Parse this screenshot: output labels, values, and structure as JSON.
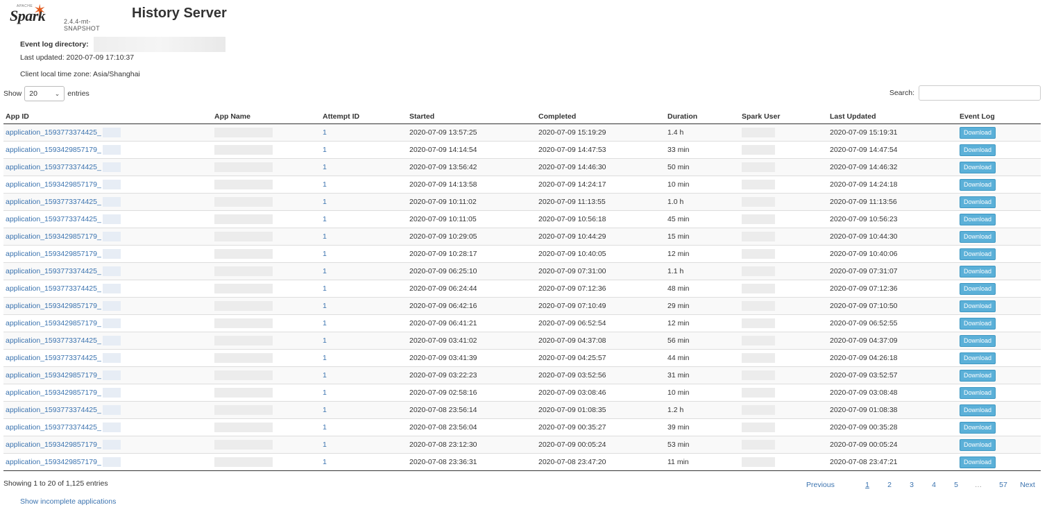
{
  "logo": {
    "wordmark": "Spark",
    "apache": "APACHE",
    "version": "2.4.4-mt-SNAPSHOT"
  },
  "page_title": "History Server",
  "info": {
    "event_log_label": "Event log directory:",
    "last_updated": "Last updated: 2020-07-09 17:10:37",
    "timezone": "Client local time zone: Asia/Shanghai"
  },
  "controls": {
    "show_label": "Show",
    "entries_label": "entries",
    "page_size": "20",
    "search_label": "Search:"
  },
  "columns": [
    "App ID",
    "App Name",
    "Attempt ID",
    "Started",
    "Completed",
    "Duration",
    "Spark User",
    "Last Updated",
    "Event Log"
  ],
  "rows": [
    {
      "app_id": "application_1593773374425_",
      "attempt": "1",
      "started": "2020-07-09 13:57:25",
      "completed": "2020-07-09 15:19:29",
      "duration": "1.4 h",
      "last_updated": "2020-07-09 15:19:31",
      "event_log": "Download"
    },
    {
      "app_id": "application_1593429857179_",
      "attempt": "1",
      "started": "2020-07-09 14:14:54",
      "completed": "2020-07-09 14:47:53",
      "duration": "33 min",
      "last_updated": "2020-07-09 14:47:54",
      "event_log": "Download"
    },
    {
      "app_id": "application_1593773374425_",
      "attempt": "1",
      "started": "2020-07-09 13:56:42",
      "completed": "2020-07-09 14:46:30",
      "duration": "50 min",
      "last_updated": "2020-07-09 14:46:32",
      "event_log": "Download"
    },
    {
      "app_id": "application_1593429857179_",
      "attempt": "1",
      "started": "2020-07-09 14:13:58",
      "completed": "2020-07-09 14:24:17",
      "duration": "10 min",
      "last_updated": "2020-07-09 14:24:18",
      "event_log": "Download"
    },
    {
      "app_id": "application_1593773374425_",
      "attempt": "1",
      "started": "2020-07-09 10:11:02",
      "completed": "2020-07-09 11:13:55",
      "duration": "1.0 h",
      "last_updated": "2020-07-09 11:13:56",
      "event_log": "Download"
    },
    {
      "app_id": "application_1593773374425_",
      "attempt": "1",
      "started": "2020-07-09 10:11:05",
      "completed": "2020-07-09 10:56:18",
      "duration": "45 min",
      "last_updated": "2020-07-09 10:56:23",
      "event_log": "Download"
    },
    {
      "app_id": "application_1593429857179_",
      "attempt": "1",
      "started": "2020-07-09 10:29:05",
      "completed": "2020-07-09 10:44:29",
      "duration": "15 min",
      "last_updated": "2020-07-09 10:44:30",
      "event_log": "Download"
    },
    {
      "app_id": "application_1593429857179_",
      "attempt": "1",
      "started": "2020-07-09 10:28:17",
      "completed": "2020-07-09 10:40:05",
      "duration": "12 min",
      "last_updated": "2020-07-09 10:40:06",
      "event_log": "Download"
    },
    {
      "app_id": "application_1593773374425_",
      "attempt": "1",
      "started": "2020-07-09 06:25:10",
      "completed": "2020-07-09 07:31:00",
      "duration": "1.1 h",
      "last_updated": "2020-07-09 07:31:07",
      "event_log": "Download"
    },
    {
      "app_id": "application_1593773374425_",
      "attempt": "1",
      "started": "2020-07-09 06:24:44",
      "completed": "2020-07-09 07:12:36",
      "duration": "48 min",
      "last_updated": "2020-07-09 07:12:36",
      "event_log": "Download"
    },
    {
      "app_id": "application_1593429857179_",
      "attempt": "1",
      "started": "2020-07-09 06:42:16",
      "completed": "2020-07-09 07:10:49",
      "duration": "29 min",
      "last_updated": "2020-07-09 07:10:50",
      "event_log": "Download"
    },
    {
      "app_id": "application_1593429857179_",
      "attempt": "1",
      "started": "2020-07-09 06:41:21",
      "completed": "2020-07-09 06:52:54",
      "duration": "12 min",
      "last_updated": "2020-07-09 06:52:55",
      "event_log": "Download"
    },
    {
      "app_id": "application_1593773374425_",
      "attempt": "1",
      "started": "2020-07-09 03:41:02",
      "completed": "2020-07-09 04:37:08",
      "duration": "56 min",
      "last_updated": "2020-07-09 04:37:09",
      "event_log": "Download"
    },
    {
      "app_id": "application_1593773374425_",
      "attempt": "1",
      "started": "2020-07-09 03:41:39",
      "completed": "2020-07-09 04:25:57",
      "duration": "44 min",
      "last_updated": "2020-07-09 04:26:18",
      "event_log": "Download"
    },
    {
      "app_id": "application_1593429857179_",
      "attempt": "1",
      "started": "2020-07-09 03:22:23",
      "completed": "2020-07-09 03:52:56",
      "duration": "31 min",
      "last_updated": "2020-07-09 03:52:57",
      "event_log": "Download"
    },
    {
      "app_id": "application_1593429857179_",
      "attempt": "1",
      "started": "2020-07-09 02:58:16",
      "completed": "2020-07-09 03:08:46",
      "duration": "10 min",
      "last_updated": "2020-07-09 03:08:48",
      "event_log": "Download"
    },
    {
      "app_id": "application_1593773374425_",
      "attempt": "1",
      "started": "2020-07-08 23:56:14",
      "completed": "2020-07-09 01:08:35",
      "duration": "1.2 h",
      "last_updated": "2020-07-09 01:08:38",
      "event_log": "Download"
    },
    {
      "app_id": "application_1593773374425_",
      "attempt": "1",
      "started": "2020-07-08 23:56:04",
      "completed": "2020-07-09 00:35:27",
      "duration": "39 min",
      "last_updated": "2020-07-09 00:35:28",
      "event_log": "Download"
    },
    {
      "app_id": "application_1593429857179_",
      "attempt": "1",
      "started": "2020-07-08 23:12:30",
      "completed": "2020-07-09 00:05:24",
      "duration": "53 min",
      "last_updated": "2020-07-09 00:05:24",
      "event_log": "Download"
    },
    {
      "app_id": "application_1593429857179_",
      "attempt": "1",
      "started": "2020-07-08 23:36:31",
      "completed": "2020-07-08 23:47:20",
      "duration": "11 min",
      "last_updated": "2020-07-08 23:47:21",
      "event_log": "Download"
    }
  ],
  "footer": {
    "showing": "Showing 1 to 20 of 1,125 entries",
    "pagination": [
      "Previous",
      "1",
      "2",
      "3",
      "4",
      "5",
      "…",
      "57",
      "Next"
    ],
    "incomplete_link": "Show incomplete applications"
  },
  "colors": {
    "link": "#3b73af",
    "button": "#5bb0d8",
    "spark_star": "#e25a1c"
  }
}
